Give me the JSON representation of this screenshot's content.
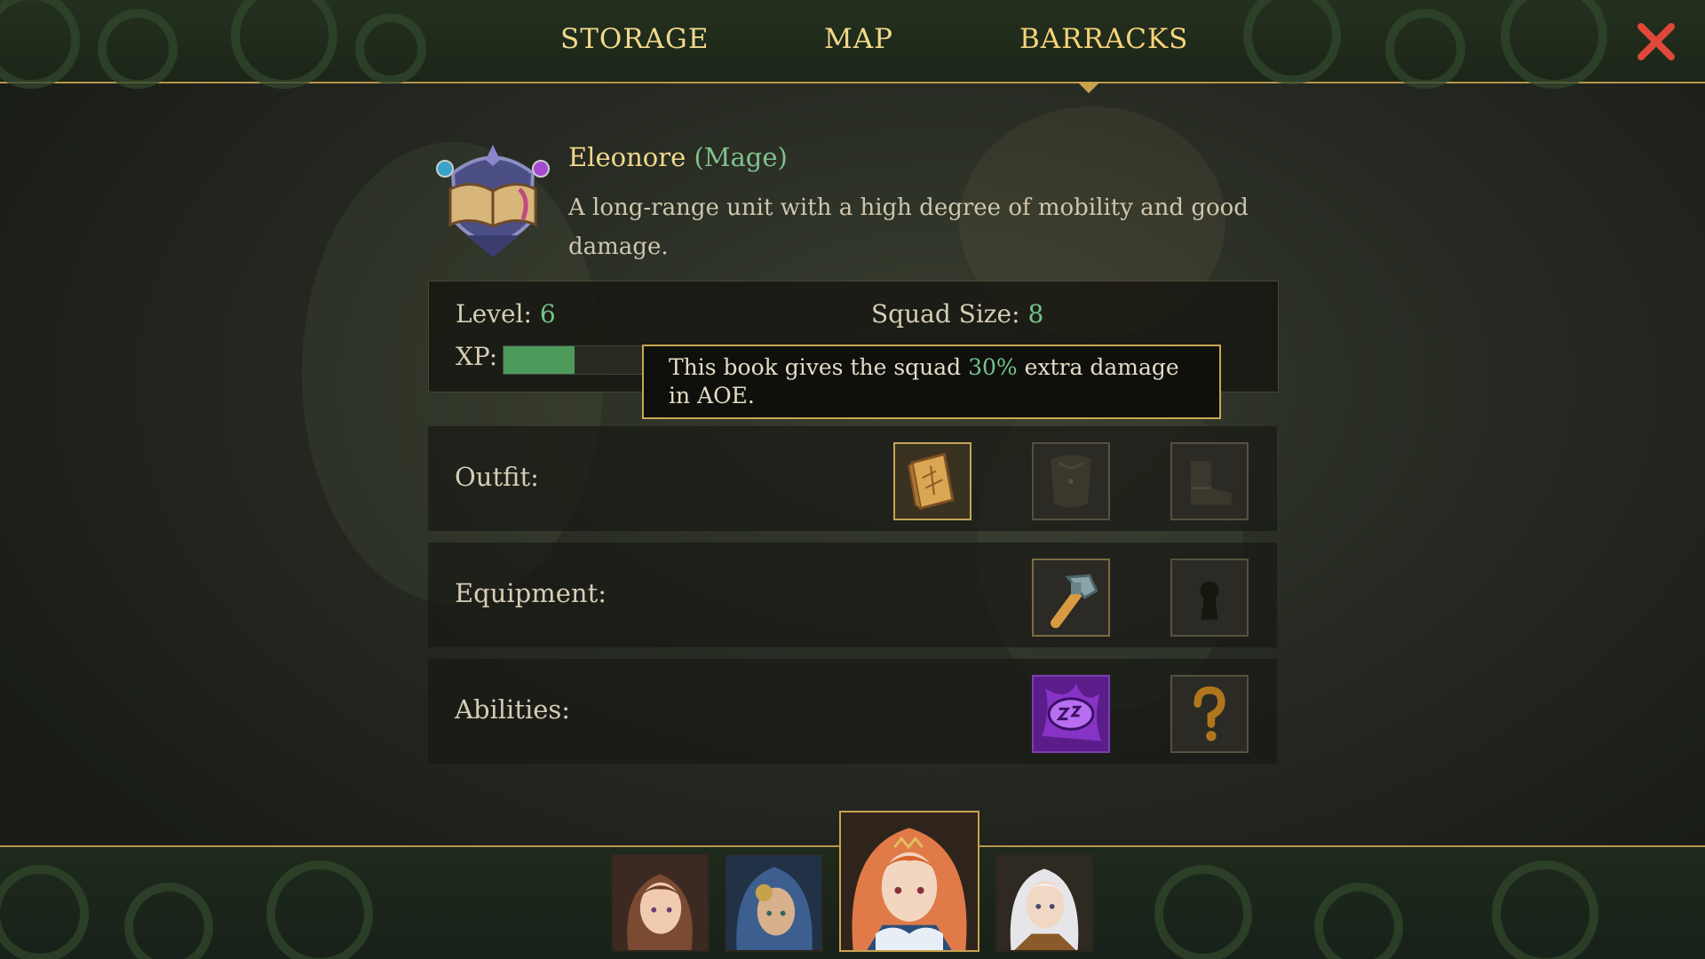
{
  "nav": {
    "tabs": [
      {
        "label": "STORAGE"
      },
      {
        "label": "MAP"
      },
      {
        "label": "BARRACKS"
      }
    ],
    "active_tab": "BARRACKS",
    "close_icon": "close-x-icon"
  },
  "unit": {
    "name": "Eleonore",
    "class_label": "(Mage)",
    "description": "A long-range unit with a high degree of mobility and good damage.",
    "emblem_icon": "spellbook-emblem-icon"
  },
  "stats": {
    "level_label": "Level: ",
    "level_value": "6",
    "squad_label": "Squad Size: ",
    "squad_value": "8",
    "xp_label": "XP:",
    "xp_fraction": 0.21
  },
  "tooltip": {
    "before": "This book gives the squad ",
    "highlight": "30%",
    "after": " extra damage in AOE."
  },
  "rows": {
    "outfit_label": "Outfit:",
    "equipment_label": "Equipment:",
    "abilities_label": "Abilities:"
  },
  "slots": {
    "outfit": [
      "golden-book-icon",
      "empty-armor-slot-icon",
      "empty-boots-slot-icon"
    ],
    "equipment": [
      "hammer-icon",
      "locked-keyhole-icon"
    ],
    "abilities": [
      "purple-sleep-ability-icon",
      "locked-question-icon"
    ]
  },
  "roster": [
    "portrait-brown-hair",
    "portrait-blue-hood",
    "portrait-orange-hair",
    "portrait-white-hair"
  ],
  "colors": {
    "gold_text": "#f1d98c",
    "green_value": "#72c48a",
    "accent_border": "#c9a24f",
    "close_red": "#e0483a"
  }
}
